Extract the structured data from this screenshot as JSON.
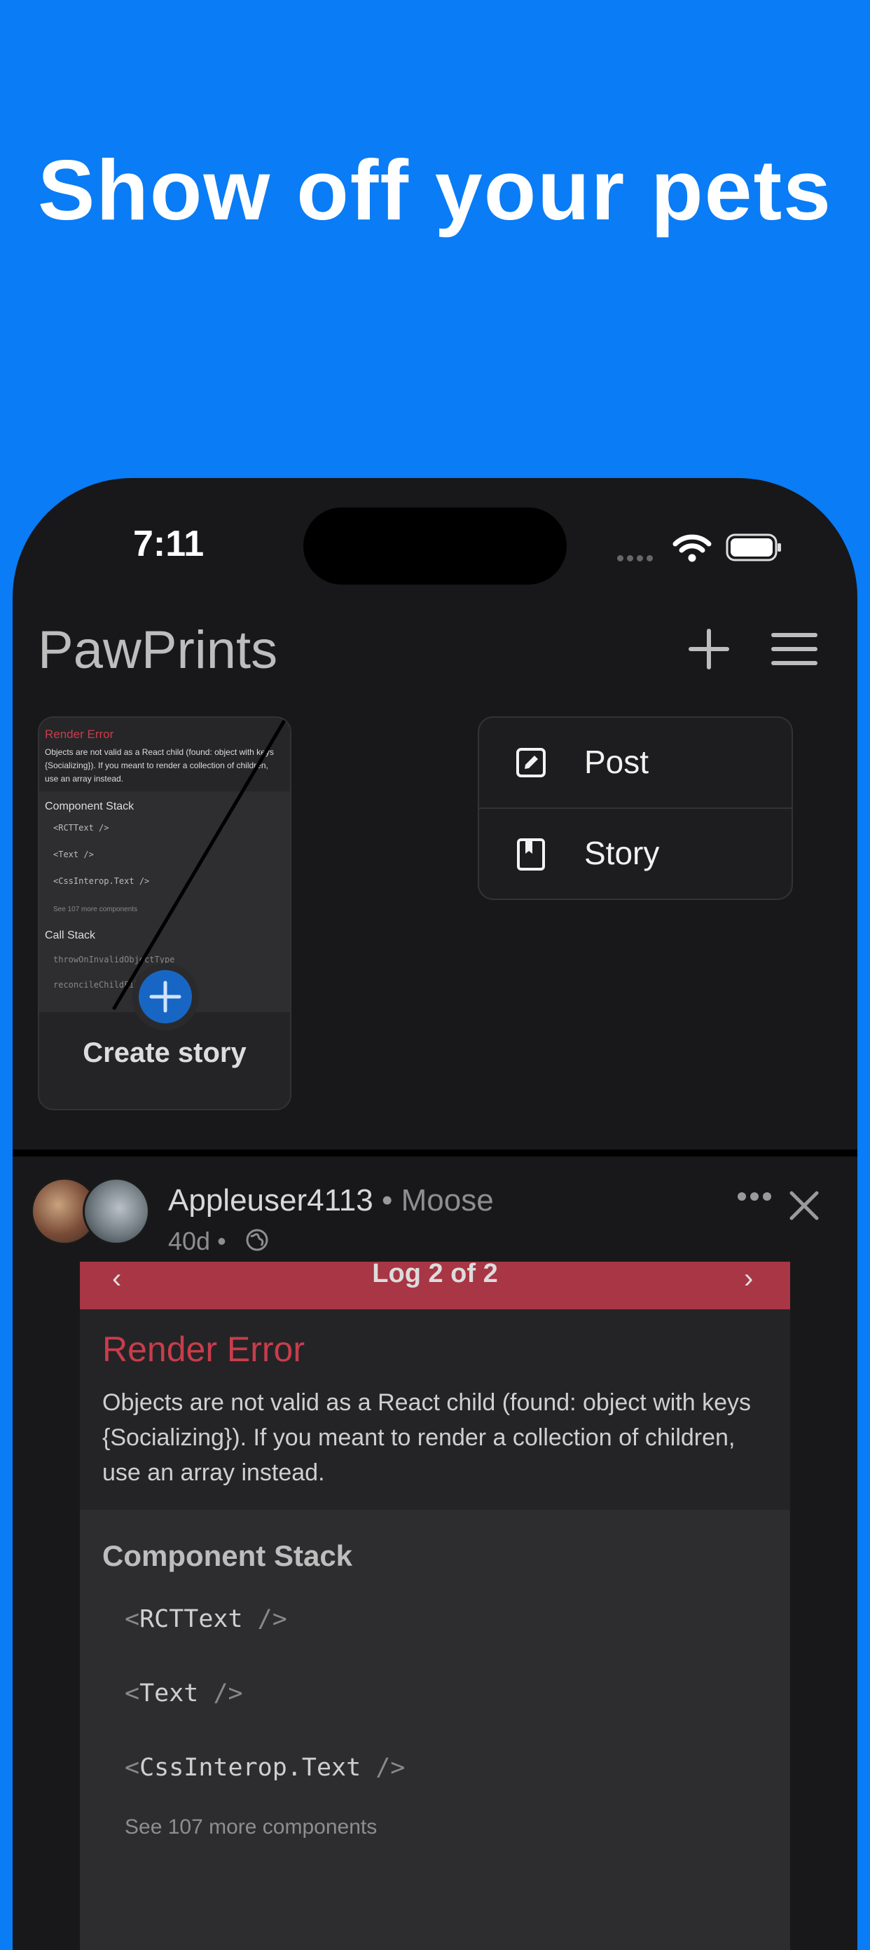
{
  "headline": "Show off your pets",
  "status_bar": {
    "time": "7:11"
  },
  "app_bar": {
    "title": "PawPrints",
    "add_icon": "plus-icon",
    "menu_icon": "hamburger-icon"
  },
  "story_card": {
    "label": "Create story",
    "thumbnail": {
      "title": "Render Error",
      "message": "Objects are not valid as a React child (found: object with keys {Socializing}). If you meant to render a collection of children, use an array instead.",
      "component_stack_title": "Component Stack",
      "lines": [
        "<RCTText />",
        "<Text />",
        "<CssInterop.Text />"
      ],
      "see_more": "See 107 more components",
      "call_stack_title": "Call Stack",
      "call_lines": [
        "throwOnInvalidObjectType",
        "reconcileChildFibers"
      ]
    }
  },
  "dropdown": {
    "items": [
      {
        "label": "Post",
        "icon": "edit-icon"
      },
      {
        "label": "Story",
        "icon": "book-icon"
      }
    ]
  },
  "post": {
    "username": "Appleuser4113",
    "separator": "•",
    "pet": "Moose",
    "age": "40d •",
    "visibility_icon": "globe-icon",
    "media": {
      "log_label": "Log 2 of 2",
      "error_title": "Render Error",
      "error_message": "Objects are not valid as a React child (found: object with keys {Socializing}). If you meant to render a collection of children, use an array instead.",
      "component_stack_title": "Component Stack",
      "stack": [
        {
          "open": "<",
          "name": "RCTText",
          "close": " />"
        },
        {
          "open": "<",
          "name": "Text",
          "close": " />"
        },
        {
          "open": "<",
          "name": "CssInterop.Text",
          "close": " />"
        }
      ],
      "see_more": "See 107 more components"
    }
  },
  "colors": {
    "background": "#0a7cf5",
    "error": "#c83d4c",
    "log_bar": "#a83645",
    "add_button": "#1866c4"
  }
}
